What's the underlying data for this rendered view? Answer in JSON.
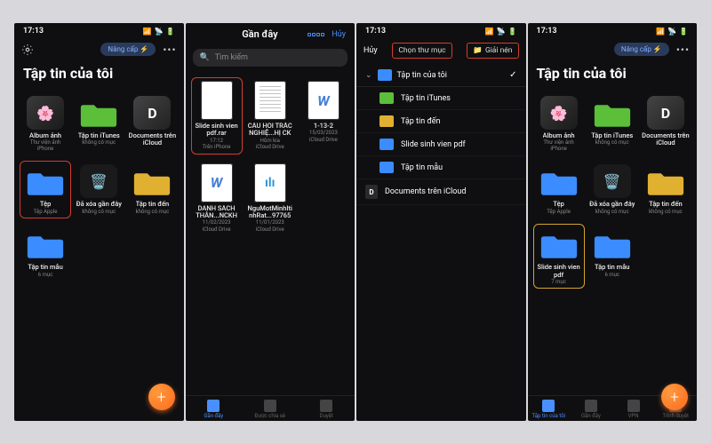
{
  "status": {
    "time": "17:13",
    "battery": "■",
    "wifi": "▲",
    "signal": "ıl"
  },
  "upgrade_pill": "Nâng cấp",
  "s1": {
    "title": "Tập tin của tôi",
    "items": [
      {
        "name": "Album ảnh",
        "sub": "Thư viện ảnh iPhone",
        "icon": "photos"
      },
      {
        "name": "Tập tin iTunes",
        "sub": "không có mục",
        "icon": "folder-green"
      },
      {
        "name": "Documents trên iCloud",
        "sub": "",
        "icon": "doc-d"
      },
      {
        "name": "Tệp",
        "sub": "Tệp Apple",
        "icon": "folder-blue",
        "hl": "red"
      },
      {
        "name": "Đã xóa gần đây",
        "sub": "không có mục",
        "icon": "trash"
      },
      {
        "name": "Tập tin đến",
        "sub": "không có mục",
        "icon": "folder-yellow"
      },
      {
        "name": "Tập tin mẫu",
        "sub": "6 mục",
        "icon": "folder-blue"
      }
    ]
  },
  "s2": {
    "header": "Gần đây",
    "cancel": "Hủy",
    "search_placeholder": "Tìm kiếm",
    "items": [
      {
        "name": "Slide sinh vien pdf.rar",
        "sub1": "17:12",
        "sub2": "Trên iPhone",
        "icon": "doc-blank",
        "hl": "red"
      },
      {
        "name": "CÂU HỎI TRẮC NGHIỆ...HỊ CK",
        "sub1": "Hôm kia",
        "sub2": "iCloud Drive",
        "icon": "doc-lines"
      },
      {
        "name": "1-13-2",
        "sub1": "15/03/2023",
        "sub2": "iCloud Drive",
        "icon": "doc-w"
      },
      {
        "name": "DANH SÁCH THÂN...NCKH",
        "sub1": "11/02/2023",
        "sub2": "iCloud Drive",
        "icon": "doc-w"
      },
      {
        "name": "NguMotMinhIti nhRat...97765",
        "sub1": "11/01/2023",
        "sub2": "iCloud Drive",
        "icon": "doc-audio"
      }
    ],
    "tabs": [
      "Gần đây",
      "Được chia sẻ",
      "Duyệt"
    ]
  },
  "s3": {
    "cancel": "Hủy",
    "choose_folder": "Chọn thư mục",
    "extract": "Giải nén",
    "root": "Tập tin của tôi",
    "rows": [
      {
        "label": "Tập tin iTunes",
        "color": "green"
      },
      {
        "label": "Tập tin đến",
        "color": "yellow"
      },
      {
        "label": "Slide sinh vien pdf",
        "color": "blue"
      },
      {
        "label": "Tập tin mẫu",
        "color": "blue"
      }
    ],
    "icloud": "Documents trên iCloud"
  },
  "s4": {
    "title": "Tập tin của tôi",
    "items": [
      {
        "name": "Album ảnh",
        "sub": "Thư viện ảnh iPhone",
        "icon": "photos"
      },
      {
        "name": "Tập tin iTunes",
        "sub": "không có mục",
        "icon": "folder-green"
      },
      {
        "name": "Documents trên iCloud",
        "sub": "",
        "icon": "doc-d"
      },
      {
        "name": "Tệp",
        "sub": "Tệp Apple",
        "icon": "folder-blue"
      },
      {
        "name": "Đã xóa gần đây",
        "sub": "không có mục",
        "icon": "trash"
      },
      {
        "name": "Tập tin đến",
        "sub": "không có mục",
        "icon": "folder-yellow"
      },
      {
        "name": "Slide sinh vien pdf",
        "sub": "7 mục",
        "icon": "folder-blue",
        "hl": "yellow"
      },
      {
        "name": "Tập tin mẫu",
        "sub": "6 mục",
        "icon": "folder-blue"
      }
    ],
    "tabs": [
      "Tập tin của tôi",
      "Gần đây",
      "VPN",
      "Trình duyệt"
    ]
  }
}
